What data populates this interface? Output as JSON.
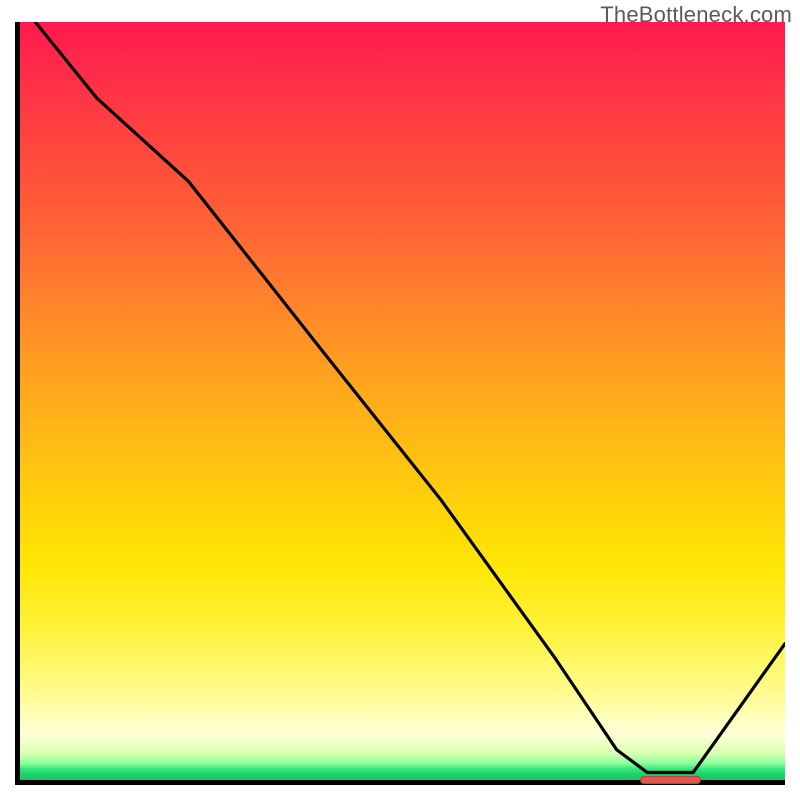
{
  "watermark": "TheBottleneck.com",
  "colors": {
    "axis": "#000000",
    "curve": "#000000",
    "marker": "#e2584e",
    "watermark_text": "#5a5a5a"
  },
  "chart_data": {
    "type": "line",
    "title": "",
    "xlabel": "",
    "ylabel": "",
    "xlim": [
      0,
      100
    ],
    "ylim": [
      0,
      100
    ],
    "grid": false,
    "legend": false,
    "series": [
      {
        "name": "bottleneck-curve",
        "x": [
          2,
          10,
          22,
          40,
          55,
          70,
          78,
          82,
          88,
          100
        ],
        "y": [
          100,
          90,
          79,
          56,
          37,
          16,
          4,
          1,
          1,
          18
        ]
      }
    ],
    "marker": {
      "name": "optimal-range",
      "x_start": 80.5,
      "x_end": 88.5,
      "y": 0.7
    },
    "gradient_stops_note": "vertical red-to-green heat gradient; green only at very bottom"
  }
}
